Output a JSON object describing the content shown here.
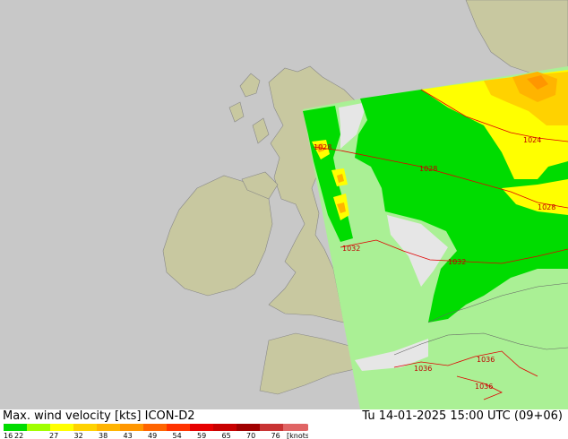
{
  "footer": {
    "title": "Max. wind velocity [kts]",
    "model": "ICON-D2",
    "valid_time": "Tu 14-01-2025 15:00 UTC (09+06)"
  },
  "legend": {
    "ticks": [
      "16",
      "22",
      "27",
      "32",
      "38",
      "43",
      "49",
      "54",
      "59",
      "65",
      "70",
      "76"
    ],
    "unit": "[knots]",
    "colors": [
      "#00dc00",
      "#a0ff00",
      "#ffff00",
      "#ffd200",
      "#ffb400",
      "#ff9600",
      "#ff6400",
      "#ff3200",
      "#e60000",
      "#c80000",
      "#a00000",
      "#c83232",
      "#e06464"
    ]
  },
  "isobars": [
    "1028",
    "1024",
    "1028",
    "1028",
    "1032",
    "1032",
    "1036",
    "1036",
    "1036"
  ],
  "colors": {
    "land": "#c8c8a0",
    "sea": "#c8c8c8",
    "model_domain": "#aaf095",
    "isobar": "#e00000",
    "coast": "#646464"
  }
}
